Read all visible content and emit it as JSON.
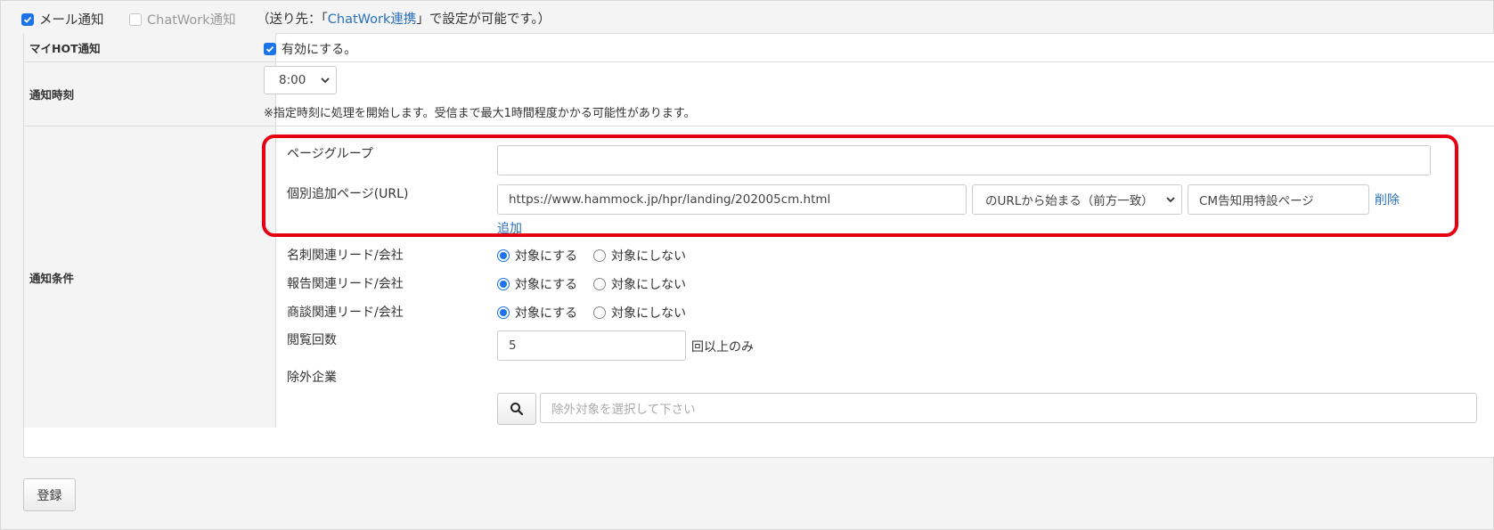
{
  "notify_channels": {
    "mail_label": "メール通知",
    "mail_checked": true,
    "chatwork_label": "ChatWork通知",
    "chatwork_checked": false,
    "dest_prefix": "（送り先：「",
    "dest_link": "ChatWork連携",
    "dest_suffix": "」で設定が可能です。）"
  },
  "rows": {
    "myhot": {
      "label": "マイHOT通知",
      "enable_label": "有効にする。",
      "enable_checked": true
    },
    "time": {
      "label": "通知時刻",
      "value": "8:00",
      "note": "※指定時刻に処理を開始します。受信まで最大1時間程度かかる可能性があります。"
    },
    "conditions": {
      "label": "通知条件",
      "page_group_label": "ページグループ",
      "page_group_value": "",
      "individual_page_label": "個別追加ページ(URL)",
      "url_value": "https://www.hammock.jp/hpr/landing/202005cm.html",
      "match_select": "のURLから始まる（前方一致）",
      "page_name_value": "CM告知用特設ページ",
      "delete_link": "削除",
      "add_link": "追加",
      "radio_rows": [
        {
          "label": "名刺関連リード/会社",
          "option_yes": "対象にする",
          "option_no": "対象にしない",
          "selected": "yes"
        },
        {
          "label": "報告関連リード/会社",
          "option_yes": "対象にする",
          "option_no": "対象にしない",
          "selected": "yes"
        },
        {
          "label": "商談関連リード/会社",
          "option_yes": "対象にする",
          "option_no": "対象にしない",
          "selected": "yes"
        }
      ],
      "view_count_label": "閲覧回数",
      "view_count_value": "5",
      "view_count_suffix": "回以上のみ",
      "exclude_label": "除外企業",
      "exclude_placeholder": "除外対象を選択して下さい"
    }
  },
  "submit_label": "登録",
  "colors": {
    "accent": "#1a73e8",
    "link": "#2a6fba",
    "highlight": "#e60012"
  }
}
